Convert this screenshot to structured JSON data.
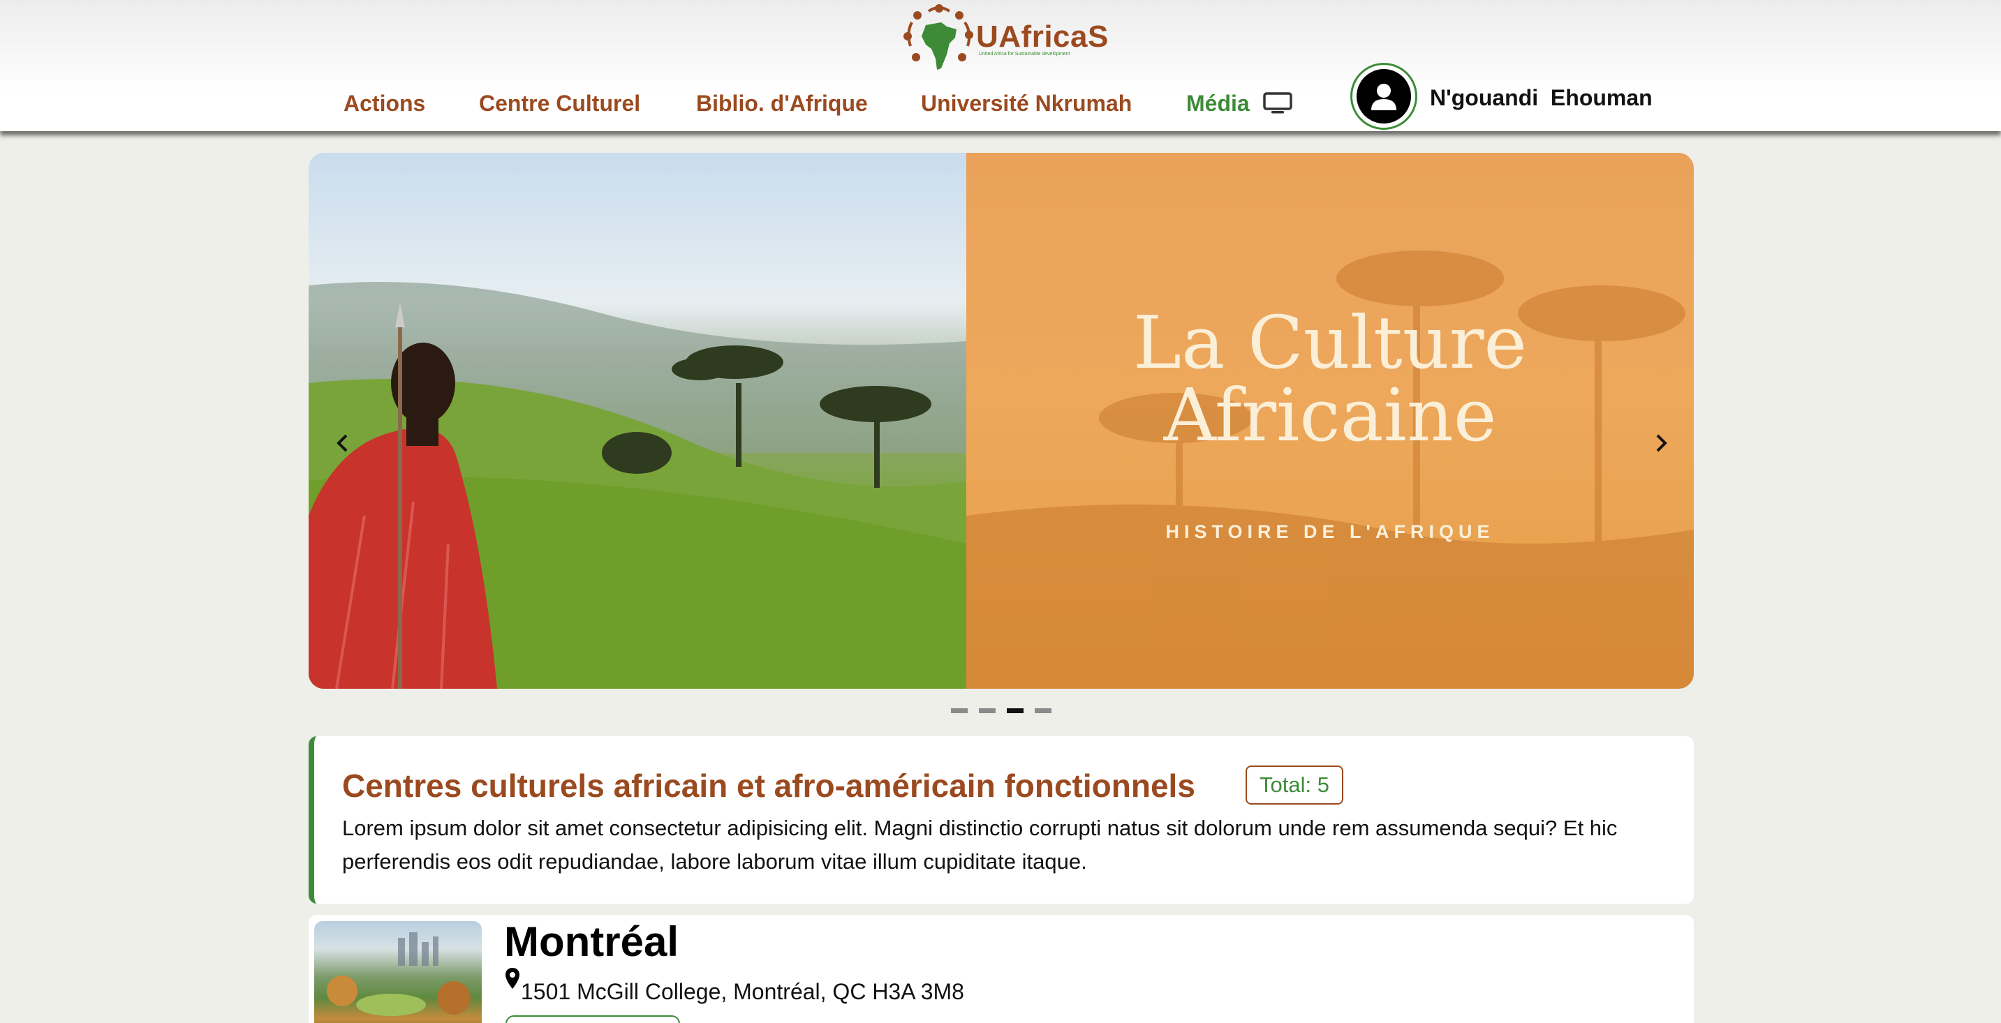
{
  "brand": {
    "name": "UAfricaS",
    "tagline": "United Africa for Sustainable development",
    "colors": {
      "primary_brown": "#9b4a20",
      "primary_green": "#3d8b37"
    }
  },
  "nav": {
    "items": [
      {
        "label": "Actions"
      },
      {
        "label": "Centre Culturel"
      },
      {
        "label": "Biblio. d'Afrique"
      },
      {
        "label": "Université Nkrumah"
      },
      {
        "label": "Média",
        "icon": "tv-icon"
      }
    ]
  },
  "user": {
    "name": "N'gouandi  Ehouman",
    "icon": "user-icon"
  },
  "carousel": {
    "slide_title_line1": "La Culture",
    "slide_title_line2": "Africaine",
    "slide_subtitle": "HISTOIRE DE L'AFRIQUE",
    "active_index": 2,
    "slide_count": 4,
    "prev_icon": "chevron-left-icon",
    "next_icon": "chevron-right-icon"
  },
  "info": {
    "title": "Centres culturels africain et afro-américain fonctionnels",
    "badge": "Total: 5",
    "description": "Lorem ipsum dolor sit amet consectetur adipisicing elit. Magni distinctio corrupti natus sit dolorum unde rem assumenda sequi? Et hic perferendis eos odit repudiandae, labore laborum vitae illum cupiditate itaque."
  },
  "centers": [
    {
      "city": "Montréal",
      "address": "1501 McGill College, Montréal, QC H3A 3M8",
      "icon": "map-pin-icon"
    }
  ]
}
